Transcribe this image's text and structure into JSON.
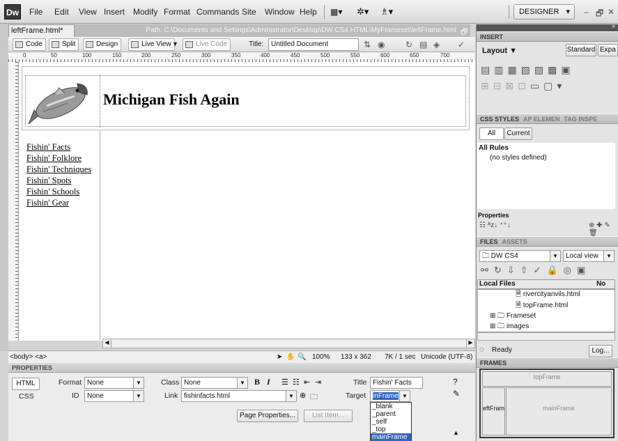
{
  "app": {
    "logo": "Dw",
    "menus": [
      "File",
      "Edit",
      "View",
      "Insert",
      "Modify",
      "Format",
      "Commands",
      "Site",
      "Window",
      "Help"
    ],
    "workspace": "DESIGNER",
    "window_controls": [
      "–",
      "🗗",
      "✕"
    ]
  },
  "document": {
    "tab_label": "leftFrame.html*",
    "tab_close": "×",
    "path": "Path: C:\\Documents and Settings\\Administrator\\Desktop\\DW CS4 HTML\\MyFrameset\\leftFrame.html",
    "views": {
      "code": "Code",
      "split": "Split",
      "design": "Design",
      "live_view": "Live View",
      "live_code": "Live Code"
    },
    "title_label": "Title:",
    "title_value": "Untitled Document",
    "ruler_marks": [
      "0",
      "50",
      "100",
      "150",
      "200",
      "250",
      "300",
      "350",
      "400",
      "450",
      "500",
      "550",
      "600",
      "650",
      "700"
    ]
  },
  "page": {
    "site_title": "Michigan Fish Again",
    "nav_links": [
      "Fishin' Facts",
      "Fishin' Folklore",
      "Fishin' Techniques",
      "Fishin' Spots",
      "Fishin' Schools",
      "Fishin' Gear"
    ]
  },
  "status": {
    "tag_selector": "<body> <a>",
    "zoom": "100%",
    "size": "133 x 362",
    "download": "7K / 1 sec",
    "encoding": "Unicode (UTF-8)"
  },
  "properties": {
    "header": "PROPERTIES",
    "html_btn": "HTML",
    "css_btn": "CSS",
    "format_label": "Format",
    "format_value": "None",
    "id_label": "ID",
    "id_value": "None",
    "class_label": "Class",
    "class_value": "None",
    "link_label": "Link",
    "link_value": "fishinfacts.html",
    "title_label": "Title",
    "title_value": "Fishin' Facts",
    "target_label": "Target",
    "target_value": "inFrame",
    "bold": "B",
    "italic": "I",
    "page_properties_btn": "Page Properties...",
    "list_item_btn": "List Item...",
    "target_options": [
      "_blank",
      "_parent",
      "_self",
      "_top",
      "mainFrame"
    ],
    "target_selected_index": 4
  },
  "insert_panel": {
    "header": "INSERT",
    "category": "Layout",
    "standard_btn": "Standard",
    "expanded_btn": "Expa"
  },
  "css_panel": {
    "tabs": [
      "CSS STYLES",
      "AP ELEMEN",
      "TAG INSPE"
    ],
    "all_btn": "All",
    "current_btn": "Current",
    "all_rules_label": "All Rules",
    "no_styles": "(no styles defined)",
    "properties_label": "Properties"
  },
  "files_panel": {
    "tabs": [
      "FILES",
      "ASSETS"
    ],
    "site": "DW CS4",
    "view": "Local view",
    "local_files_label": "Local Files",
    "col2": "No",
    "files": [
      {
        "name": "rivercityanvils.html",
        "type": "file"
      },
      {
        "name": "topFrame.html",
        "type": "file"
      },
      {
        "name": "Frameset",
        "type": "folder"
      },
      {
        "name": "images",
        "type": "folder"
      }
    ],
    "ready": "Ready",
    "log_btn": "Log..."
  },
  "frames_panel": {
    "header": "FRAMES",
    "top": "topFrame",
    "left": "eftFrame",
    "main": "mainFrame"
  }
}
